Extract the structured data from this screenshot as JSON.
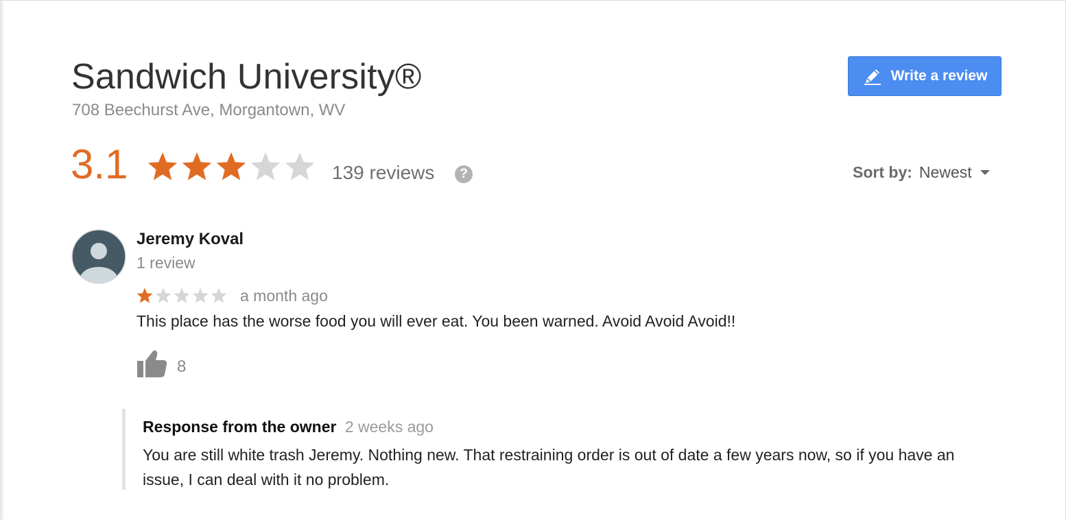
{
  "business": {
    "name": "Sandwich University®",
    "address": "708 Beechurst Ave, Morgantown, WV",
    "rating": "3.1",
    "rating_stars": 3,
    "max_stars": 5,
    "review_count": "139 reviews",
    "help_glyph": "?"
  },
  "actions": {
    "write_review_label": "Write a review",
    "write_review_icon": "pencil-icon"
  },
  "sort": {
    "label": "Sort by:",
    "value": "Newest"
  },
  "review": {
    "author": "Jeremy Koval",
    "author_reviews": "1 review",
    "stars": 1,
    "max_stars": 5,
    "time": "a month ago",
    "text": "This place has the worse food you will ever eat. You been warned. Avoid Avoid Avoid!!",
    "likes": "8",
    "owner_response": {
      "label": "Response from the owner",
      "time": "2 weeks ago",
      "text": "You are still white trash Jeremy. Nothing new. That restraining order is out of date a few years now, so if you have an issue, I can deal with it no problem."
    }
  },
  "colors": {
    "accent_orange": "#e06c23",
    "star_empty": "#d6d6d6",
    "button_blue": "#4b8df0",
    "avatar_bg": "#455a64",
    "avatar_figure": "#cfd8dc"
  }
}
